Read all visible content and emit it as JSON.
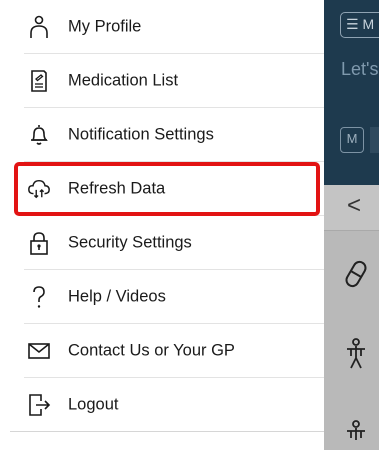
{
  "background_app": {
    "menu_button_label": "☰ M",
    "greeting": "Let's Thac",
    "chip_label": "M",
    "back_label": "<"
  },
  "drawer": {
    "items": [
      {
        "label": "My Profile",
        "icon": "person-icon"
      },
      {
        "label": "Medication List",
        "icon": "document-icon"
      },
      {
        "label": "Notification Settings",
        "icon": "bell-icon"
      },
      {
        "label": "Refresh Data",
        "icon": "cloud-refresh-icon",
        "highlighted": true
      },
      {
        "label": "Security Settings",
        "icon": "lock-icon"
      },
      {
        "label": "Help / Videos",
        "icon": "question-icon"
      },
      {
        "label": "Contact Us or Your GP",
        "icon": "envelope-icon"
      },
      {
        "label": "Logout",
        "icon": "logout-icon"
      }
    ]
  },
  "colors": {
    "highlight_border": "#e21313",
    "header_bg": "#1e3a4e",
    "overlay_gray": "#b9b9b9"
  }
}
